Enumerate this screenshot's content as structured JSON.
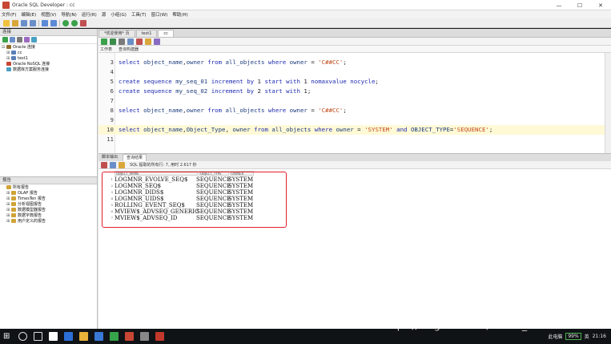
{
  "window": {
    "title": "Oracle SQL Developer : cc",
    "minimize": "—",
    "maximize": "☐",
    "close": "✕"
  },
  "menu": [
    "文件(F)",
    "编辑(E)",
    "视图(V)",
    "导航(N)",
    "运行(R)",
    "源",
    "小组(G)",
    "工具(T)",
    "窗口(W)",
    "帮助(H)"
  ],
  "left_panel": {
    "title": "连接",
    "tree": [
      {
        "label": "Oracle 连接",
        "expander": "⊟"
      },
      {
        "label": "cc",
        "expander": "⊞"
      },
      {
        "label": "test1",
        "expander": "⊞"
      },
      {
        "label": "Oracle NoSQL 连接",
        "expander": ""
      },
      {
        "label": "数据库方案服务连接",
        "expander": ""
      }
    ],
    "reports_title": "报告",
    "reports": [
      {
        "label": "所有报告",
        "expander": ""
      },
      {
        "label": "OLAP 报告",
        "expander": "⊞"
      },
      {
        "label": "TimesTen 报告",
        "expander": "⊞"
      },
      {
        "label": "分析视图报告",
        "expander": "⊞"
      },
      {
        "label": "数据模型器报告",
        "expander": "⊞"
      },
      {
        "label": "数据字典报告",
        "expander": "⊞"
      },
      {
        "label": "用户定义的报告",
        "expander": "⊞"
      }
    ]
  },
  "editor": {
    "tabs": [
      "*欢迎使用* 页",
      "test1",
      "cc"
    ],
    "subtabs": [
      "工作表",
      "查询构建器"
    ],
    "lines": [
      {
        "num": "3",
        "parts": [
          [
            "kw",
            "select "
          ],
          [
            "id",
            "object_name"
          ],
          [
            "",
            ","
          ],
          [
            "id",
            "owner"
          ],
          [
            "kw",
            " from "
          ],
          [
            "id",
            "all_objects"
          ],
          [
            "kw",
            " where "
          ],
          [
            "id",
            "owner"
          ],
          [
            "",
            " = "
          ],
          [
            "str",
            "'C##CC'"
          ],
          [
            "",
            ";"
          ]
        ]
      },
      {
        "num": "4",
        "parts": []
      },
      {
        "num": "5",
        "parts": [
          [
            "kw",
            "create sequence "
          ],
          [
            "id",
            "my_seq_01"
          ],
          [
            "kw",
            " increment by "
          ],
          [
            "",
            "1"
          ],
          [
            "kw",
            " start with "
          ],
          [
            "",
            "1"
          ],
          [
            "kw",
            " nomaxvalue nocycle"
          ],
          [
            "",
            ";"
          ]
        ]
      },
      {
        "num": "6",
        "parts": [
          [
            "kw",
            "create sequence "
          ],
          [
            "id",
            "my_seq_02"
          ],
          [
            "kw",
            " increment by "
          ],
          [
            "",
            "2"
          ],
          [
            "kw",
            " start with "
          ],
          [
            "",
            "1"
          ],
          [
            "",
            ";"
          ]
        ]
      },
      {
        "num": "7",
        "parts": []
      },
      {
        "num": "8",
        "parts": [
          [
            "kw",
            "select "
          ],
          [
            "id",
            "object_name"
          ],
          [
            "",
            ","
          ],
          [
            "id",
            "owner"
          ],
          [
            "kw",
            " from "
          ],
          [
            "id",
            "all_objects"
          ],
          [
            "kw",
            " where "
          ],
          [
            "id",
            "owner"
          ],
          [
            "",
            " = "
          ],
          [
            "str",
            "'C##CC'"
          ],
          [
            "",
            ";"
          ]
        ]
      },
      {
        "num": "9",
        "parts": []
      },
      {
        "num": "10",
        "parts": [
          [
            "kw",
            "select "
          ],
          [
            "id",
            "object_name"
          ],
          [
            "",
            ","
          ],
          [
            "id",
            "Object_Type"
          ],
          [
            "",
            ", "
          ],
          [
            "id",
            "owner"
          ],
          [
            "kw",
            " from "
          ],
          [
            "id",
            "all_objects"
          ],
          [
            "kw",
            " where "
          ],
          [
            "id",
            "owner"
          ],
          [
            "",
            " = "
          ],
          [
            "str",
            "'SYSTEM'"
          ],
          [
            "kw",
            " and "
          ],
          [
            "id",
            "OBJECT_TYPE"
          ],
          [
            "",
            "="
          ],
          [
            "str",
            "'SEQUENCE'"
          ],
          [
            "",
            ";"
          ]
        ]
      },
      {
        "num": "11",
        "parts": []
      }
    ]
  },
  "output": {
    "tabs": [
      "脚本输出",
      "查询结果"
    ],
    "toolbar_text": "SQL  提取的所有行: 7, 用时 2.617 秒",
    "columns": [
      "OBJECT_NAME",
      "OBJECT_TYPE",
      "OWNER"
    ],
    "rows": [
      {
        "n": "1",
        "name": "LOGMNR_EVOLVE_SEQ$",
        "type": "SEQUENCE",
        "owner": "SYSTEM"
      },
      {
        "n": "2",
        "name": "LOGMNR_SEQ$",
        "type": "SEQUENCE",
        "owner": "SYSTEM"
      },
      {
        "n": "3",
        "name": "LOGMNR_DIDS$",
        "type": "SEQUENCE",
        "owner": "SYSTEM"
      },
      {
        "n": "4",
        "name": "LOGMNR_UIDS$",
        "type": "SEQUENCE",
        "owner": "SYSTEM"
      },
      {
        "n": "5",
        "name": "ROLLING_EVENT_SEQ$",
        "type": "SEQUENCE",
        "owner": "SYSTEM"
      },
      {
        "n": "6",
        "name": "MVIEW$_ADVSEQ_GENERIC",
        "type": "SEQUENCE",
        "owner": "SYSTEM"
      },
      {
        "n": "7",
        "name": "MVIEW$_ADVSEQ_ID",
        "type": "SEQUENCE",
        "owner": "SYSTEM"
      }
    ]
  },
  "taskbar": {
    "start": "⊞",
    "battery": "99%",
    "ime": "英",
    "time": "21:16",
    "locale_text": "此电脑"
  },
  "watermark": "https://blog.csdn.net/weixin_43644231",
  "colors": {
    "keyword": "#1e2bb0",
    "string": "#c24b1a",
    "highlight": "#fff9d6",
    "annotation": "#e0202a"
  }
}
